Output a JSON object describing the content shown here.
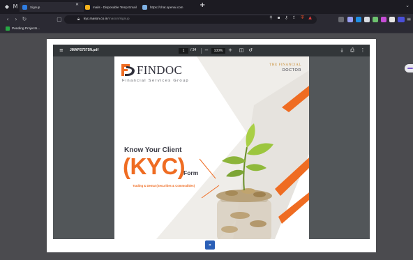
{
  "browser": {
    "tabs": [
      {
        "title": "Signup",
        "favicon_color": "#2f7de1",
        "active": true
      },
      {
        "title": "mails - Disposable Temp Email",
        "favicon_color": "#f6b21b",
        "active": false
      },
      {
        "title": "https://chat.openai.com",
        "favicon_color": "#7fb2e5",
        "active": false
      }
    ],
    "url_host": "kyc.mason.co.in",
    "url_path": "/mason/signup",
    "bookmarks": [
      {
        "label": "Pending Projects..."
      }
    ]
  },
  "pdf_viewer": {
    "file_name": "JMAPS7575N.pdf",
    "current_page": "1",
    "total_pages": "/ 34",
    "zoom": "100%"
  },
  "document": {
    "brand_letter": "FD",
    "brand_name": "FINDOC",
    "brand_sub": "Financial Services Group",
    "tagline_line1": "THE FINANCIAL",
    "tagline_line2": "DOCTOR",
    "heading": "Know Your Client",
    "big_text": "(KYC)",
    "form_word": "Form",
    "description": "Trading & Demat (Securities & Commodities)"
  },
  "colors": {
    "brand_orange": "#ef6c22",
    "pdf_toolbar": "#323639",
    "viewer_bg": "#525659",
    "nav_button": "#2a5fb7"
  },
  "footer": {
    "next_label": "»"
  }
}
